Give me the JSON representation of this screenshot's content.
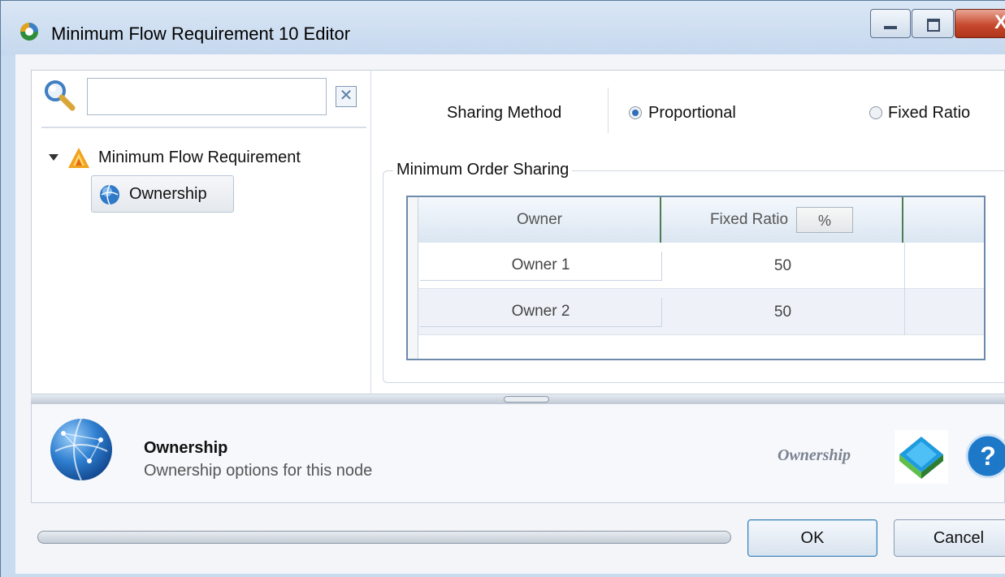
{
  "window": {
    "title": "Minimum Flow Requirement 10 Editor",
    "minimize_icon": "minimize-icon",
    "maximize_icon": "maximize-icon",
    "close_glyph": "X"
  },
  "sidebar": {
    "search": {
      "value": "",
      "placeholder": ""
    },
    "clear_glyph": "✕",
    "tree": {
      "root": {
        "label": "Minimum Flow Requirement",
        "icon": "warning-triangle-icon",
        "expanded": true
      },
      "children": [
        {
          "label": "Ownership",
          "icon": "globe-icon",
          "selected": true
        }
      ]
    }
  },
  "main": {
    "sharing_method": {
      "label": "Sharing Method",
      "options": [
        {
          "label": "Proportional",
          "selected": true
        },
        {
          "label": "Fixed Ratio",
          "selected": false
        }
      ]
    },
    "group": {
      "title": "Minimum Order Sharing",
      "columns": [
        "Owner",
        "Fixed Ratio"
      ],
      "unit_button": "%",
      "rows": [
        {
          "owner": "Owner 1",
          "ratio": "50"
        },
        {
          "owner": "Owner 2",
          "ratio": "50"
        }
      ]
    }
  },
  "info": {
    "title": "Ownership",
    "description": "Ownership options for this node",
    "tag": "Ownership"
  },
  "footer": {
    "ok": "OK",
    "cancel": "Cancel"
  },
  "colors": {
    "accent": "#2e6fb7",
    "close_button": "#c74a2f",
    "titlebar": "#c6d8ee"
  }
}
